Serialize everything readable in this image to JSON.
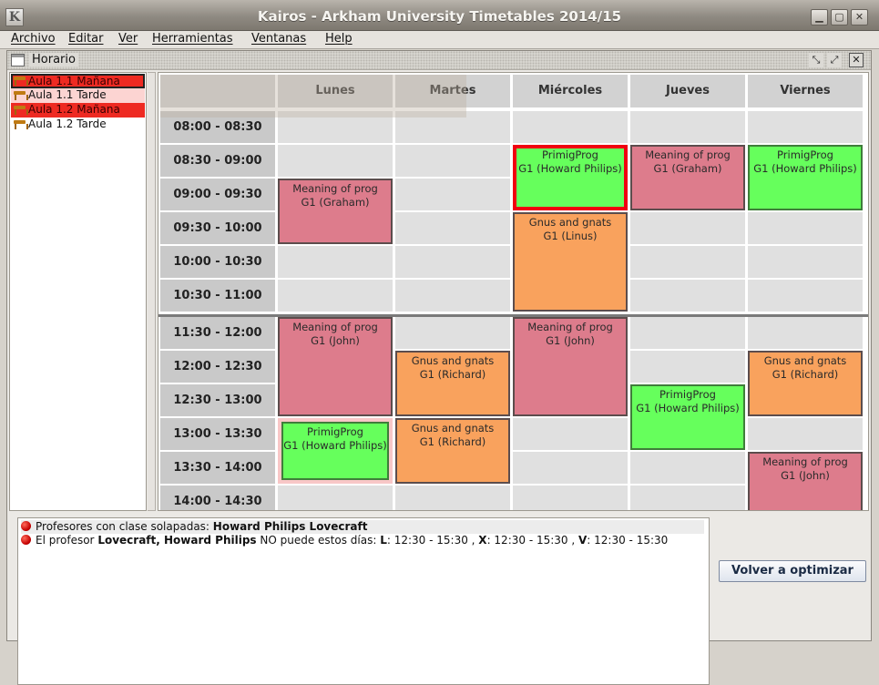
{
  "window": {
    "title": "Kairos - Arkham University Timetables 2014/15"
  },
  "menu": [
    "Archivo",
    "Editar",
    "Ver",
    "Herramientas",
    "Ventanas",
    "Help"
  ],
  "frame": {
    "title": "Horario"
  },
  "rooms": [
    {
      "label": "Aula 1.1 Mañana",
      "state": "conflict-selected"
    },
    {
      "label": "Aula 1.1 Tarde",
      "state": "ok"
    },
    {
      "label": "Aula 1.2 Mañana",
      "state": "conflict"
    },
    {
      "label": "Aula 1.2 Tarde",
      "state": "ok"
    }
  ],
  "days": [
    "Lunes",
    "Martes",
    "Miércoles",
    "Jueves",
    "Viernes"
  ],
  "times": [
    "08:00 - 08:30",
    "08:30 - 09:00",
    "09:00 - 09:30",
    "09:30 - 10:00",
    "10:00 - 10:30",
    "10:30 - 11:00",
    "11:30 - 12:00",
    "12:00 - 12:30",
    "12:30 - 13:00",
    "13:00 - 13:30",
    "13:30 - 14:00",
    "14:00 - 14:30"
  ],
  "classes": [
    {
      "subject": "Meaning of prog",
      "group": "G1 (Graham)",
      "day": 0,
      "start": 2,
      "slots": 2,
      "color": "pink"
    },
    {
      "subject": "Meaning of prog",
      "group": "G1 (John)",
      "day": 0,
      "start": 6,
      "slots": 3,
      "color": "pink"
    },
    {
      "subject": "PrimigProg",
      "group": "G1 (Howard Philips)",
      "day": 0,
      "start": 9,
      "slots": 2,
      "color": "green",
      "highlight": true
    },
    {
      "subject": "Gnus and gnats",
      "group": "G1 (Richard)",
      "day": 1,
      "start": 7,
      "slots": 2,
      "color": "orange"
    },
    {
      "subject": "Gnus and gnats",
      "group": "G1 (Richard)",
      "day": 1,
      "start": 9,
      "slots": 2,
      "color": "orange"
    },
    {
      "subject": "PrimigProg",
      "group": "G1 (Howard Philips)",
      "day": 2,
      "start": 1,
      "slots": 2,
      "color": "green",
      "conflict": true
    },
    {
      "subject": "Gnus and gnats",
      "group": "G1 (Linus)",
      "day": 2,
      "start": 3,
      "slots": 3,
      "color": "orange"
    },
    {
      "subject": "Meaning of prog",
      "group": "G1 (John)",
      "day": 2,
      "start": 6,
      "slots": 3,
      "color": "pink"
    },
    {
      "subject": "Meaning of prog",
      "group": "G1 (Graham)",
      "day": 3,
      "start": 1,
      "slots": 2,
      "color": "pink"
    },
    {
      "subject": "PrimigProg",
      "group": "G1 (Howard Philips)",
      "day": 3,
      "start": 8,
      "slots": 2,
      "color": "green"
    },
    {
      "subject": "PrimigProg",
      "group": "G1 (Howard Philips)",
      "day": 4,
      "start": 1,
      "slots": 2,
      "color": "green"
    },
    {
      "subject": "Gnus and gnats",
      "group": "G1 (Richard)",
      "day": 4,
      "start": 7,
      "slots": 2,
      "color": "orange"
    },
    {
      "subject": "Meaning of prog",
      "group": "G1 (John)",
      "day": 4,
      "start": 10,
      "slots": 2,
      "color": "pink"
    }
  ],
  "messages": {
    "m1": {
      "text": "Profesores con clase solapadas: ",
      "name": "Howard Philips Lovecraft"
    },
    "m2": {
      "pre": "El profesor ",
      "name": "Lovecraft, Howard Philips",
      "mid": " NO puede estos días: ",
      "d1": "L",
      "t1": ": 12:30 - 15:30 , ",
      "d2": "X",
      "t2": ": 12:30 - 15:30 , ",
      "d3": "V",
      "t3": ": 12:30 - 15:30"
    }
  },
  "actions": {
    "reoptimize": "Volver a optimizar"
  },
  "colors": {
    "conflict": "#ee2a22",
    "pink": "#dd7c8c",
    "orange": "#f9a25d",
    "green": "#66ff5c",
    "highlight": "#f00010"
  }
}
